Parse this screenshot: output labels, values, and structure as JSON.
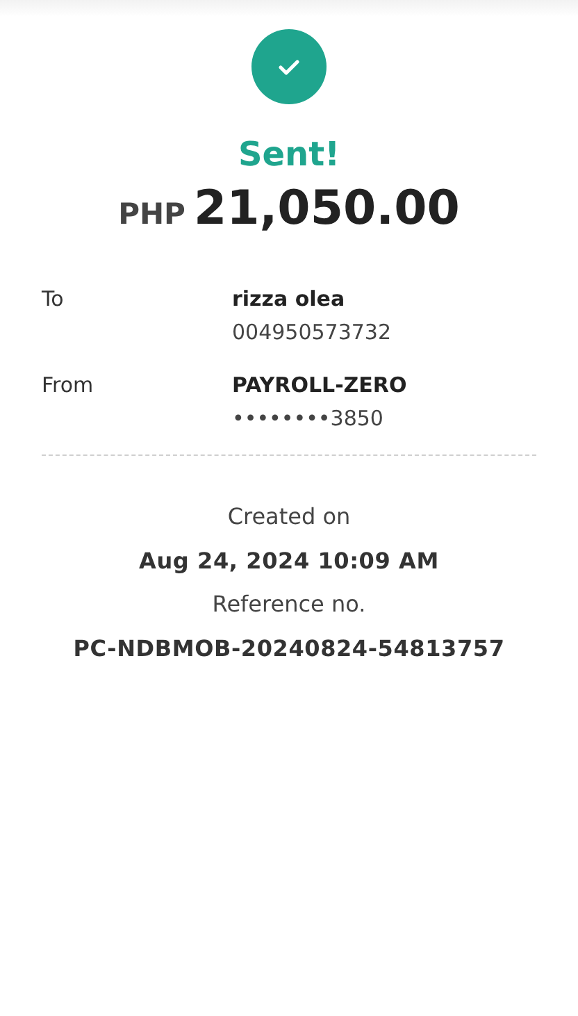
{
  "status": {
    "title": "Sent!",
    "currency": "PHP",
    "amount": "21,050.00"
  },
  "parties": [
    {
      "label": "To",
      "name": "rizza olea",
      "account": "004950573732"
    },
    {
      "label": "From",
      "name": "PAYROLL-ZERO",
      "account": "••••••••3850"
    }
  ],
  "details": [
    {
      "label": "Created on",
      "value": "Aug 24, 2024 10:09 AM"
    },
    {
      "label": "Reference no.",
      "value": "PC-NDBMOB-20240824-54813757"
    }
  ]
}
